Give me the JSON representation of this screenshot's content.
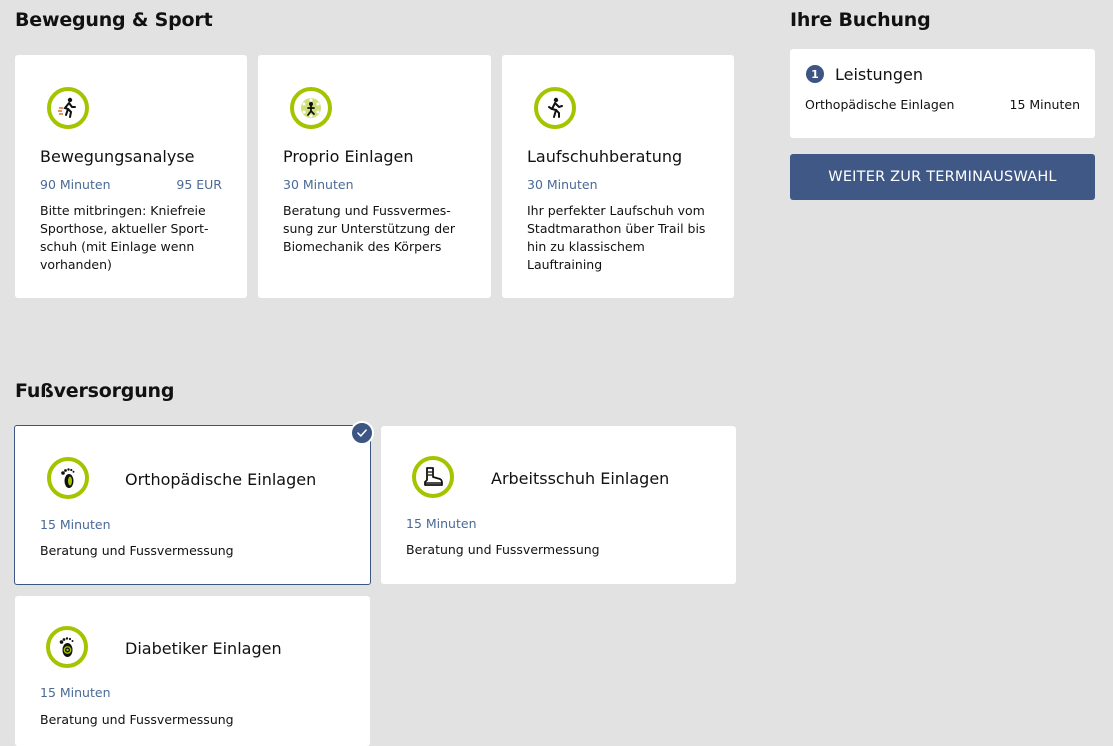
{
  "sections": {
    "sport_title": "Bewegung & Sport",
    "foot_title": "Fußversorgung",
    "booking_title": "Ihre Buchung"
  },
  "sport_cards": [
    {
      "title": "Bewegungsanalyse",
      "duration": "90 Minuten",
      "price": "95 EUR",
      "description": "Bitte mitbringen: Kniefreie Sporthose, aktueller Sport-schuh (mit Einlage wenn vorhanden)",
      "icon": "running-person-icon"
    },
    {
      "title": "Proprio Einlagen",
      "duration": "30 Minuten",
      "price": "",
      "description": "Beratung und Fussvermes-sung zur Unterstützung der Biomechanik des Körpers",
      "icon": "balance-figure-icon"
    },
    {
      "title": "Laufschuhberatung",
      "duration": "30 Minuten",
      "price": "",
      "description": "Ihr perfekter Laufschuh vom Stadtmarathon über Trail bis hin zu klassischem Lauftraining",
      "icon": "runner-icon"
    }
  ],
  "foot_cards": [
    {
      "title": "Orthopädische Einlagen",
      "duration": "15 Minuten",
      "description": "Beratung und Fussvermessung",
      "icon": "footprint-icon",
      "selected": true
    },
    {
      "title": "Arbeitsschuh Einlagen",
      "duration": "15 Minuten",
      "description": "Beratung und Fussvermessung",
      "icon": "work-boot-icon",
      "selected": false
    },
    {
      "title": "Diabetiker Einlagen",
      "duration": "15 Minuten",
      "description": "Beratung und Fussvermessung",
      "icon": "diabetic-foot-icon",
      "selected": false
    }
  ],
  "booking": {
    "step_number": "1",
    "heading": "Leistungen",
    "item_name": "Orthopädische Einlagen",
    "item_duration": "15 Minuten",
    "cta_label": "WEITER ZUR TERMINAUSWAHL"
  },
  "colors": {
    "accent_green": "#a4c400",
    "primary_blue": "#3f5886",
    "meta_blue": "#4a6a96",
    "background": "#e2e2e2"
  }
}
